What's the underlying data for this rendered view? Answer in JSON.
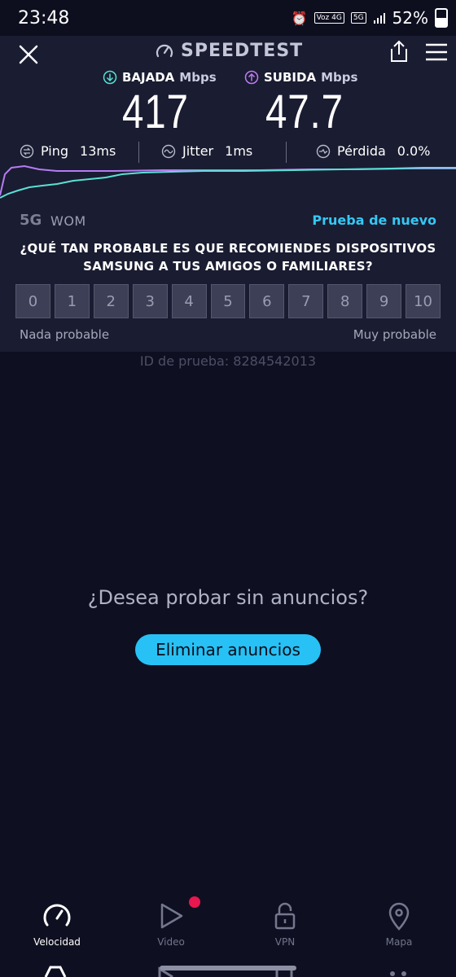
{
  "status_bar": {
    "time": "23:48",
    "volte": "Voz 4G",
    "network": "5G",
    "battery_percent": "52%",
    "icons": [
      "alarm-icon",
      "signal-icon",
      "battery-icon"
    ]
  },
  "header": {
    "brand": "SPEEDTEST",
    "icons": [
      "close-icon",
      "speedometer-icon",
      "share-icon",
      "menu-icon"
    ]
  },
  "results": {
    "download": {
      "label": "BAJADA",
      "unit": "Mbps",
      "value": "417",
      "color": "#54e3d2"
    },
    "upload": {
      "label": "SUBIDA",
      "unit": "Mbps",
      "value": "47.7",
      "color": "#c07cf5"
    }
  },
  "stats": {
    "ping": {
      "label": "Ping",
      "value": "13ms"
    },
    "jitter": {
      "label": "Jitter",
      "value": "1ms"
    },
    "loss": {
      "label": "Pérdida",
      "value": "0.0%"
    }
  },
  "connection": {
    "type": "5G",
    "carrier": "WOM",
    "retest_label": "Prueba de nuevo"
  },
  "survey": {
    "question": "¿QUÉ TAN PROBABLE ES QUE RECOMIENDES DISPOSITIVOS SAMSUNG A TUS AMIGOS O FAMILIARES?",
    "options": [
      "0",
      "1",
      "2",
      "3",
      "4",
      "5",
      "6",
      "7",
      "8",
      "9",
      "10"
    ],
    "low_label": "Nada probable",
    "high_label": "Muy probable"
  },
  "test_id": "ID de prueba: 8284542013",
  "ad": {
    "question": "¿Desea probar sin anuncios?",
    "button": "Eliminar anuncios"
  },
  "nav": {
    "items": [
      {
        "label": "Velocidad",
        "icon": "speedometer-icon",
        "active": true
      },
      {
        "label": "Video",
        "icon": "play-icon",
        "active": false,
        "badge": true
      },
      {
        "label": "VPN",
        "icon": "unlock-icon",
        "active": false
      },
      {
        "label": "Mapa",
        "icon": "map-pin-icon",
        "active": false
      }
    ]
  },
  "colors": {
    "background": "#0e1021",
    "panel": "#1a1c31",
    "accent": "#27c1f5",
    "badge": "#e8174f"
  }
}
